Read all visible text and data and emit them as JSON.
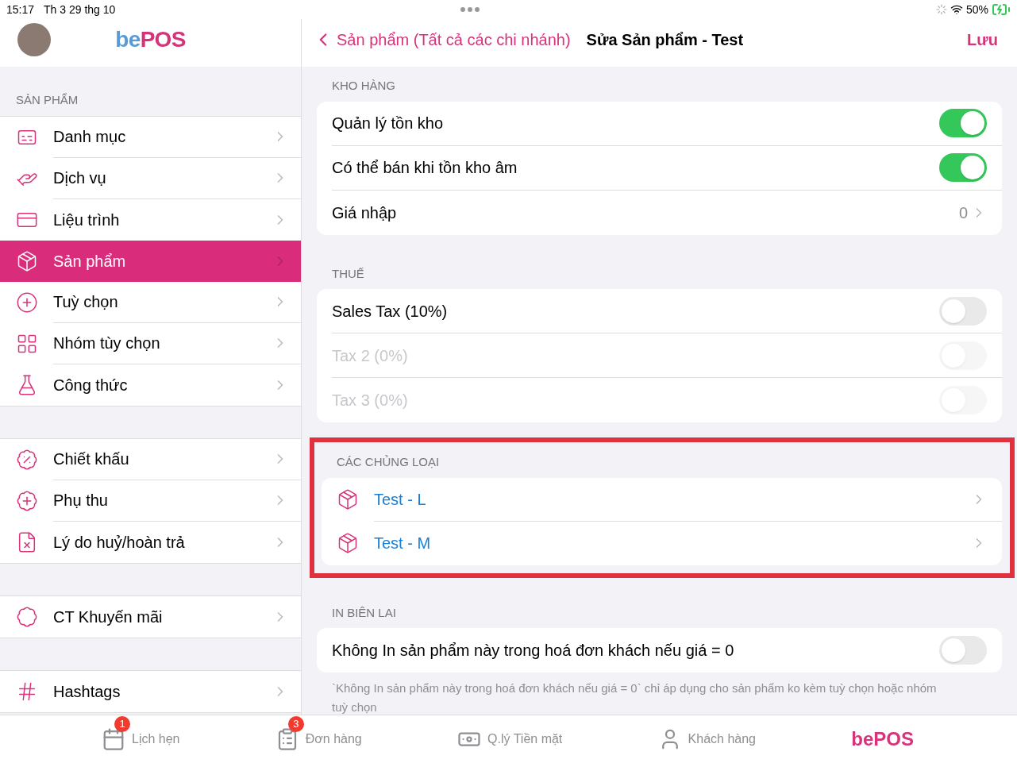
{
  "status_bar": {
    "time": "15:17",
    "date": "Th 3 29 thg 10",
    "battery": "50%"
  },
  "sidebar": {
    "logo": {
      "part_1": "be",
      "part_2": "POS"
    },
    "groups": [
      {
        "title": "SẢN PHẨM",
        "items": [
          {
            "label": "Danh mục",
            "selected": false
          },
          {
            "label": "Dịch vụ",
            "selected": false
          },
          {
            "label": "Liệu trình",
            "selected": false
          },
          {
            "label": "Sản phẩm",
            "selected": true
          },
          {
            "label": "Tuỳ chọn",
            "selected": false
          },
          {
            "label": "Nhóm tùy chọn",
            "selected": false
          },
          {
            "label": "Công thức",
            "selected": false
          }
        ]
      },
      {
        "items": [
          {
            "label": "Chiết khấu",
            "selected": false
          },
          {
            "label": "Phụ thu",
            "selected": false
          },
          {
            "label": "Lý do huỷ/hoàn trả",
            "selected": false
          }
        ]
      },
      {
        "items": [
          {
            "label": "CT Khuyến mãi",
            "selected": false
          }
        ]
      },
      {
        "items": [
          {
            "label": "Hashtags",
            "selected": false
          }
        ]
      }
    ]
  },
  "nav": {
    "back": "Sản phẩm (Tất cả các chi nhánh)",
    "title": "Sửa Sản phẩm - Test",
    "action": "Lưu"
  },
  "sections": [
    {
      "title": "KHO HÀNG",
      "highlighted": false,
      "rows": [
        {
          "kind": "toggle",
          "label": "Quản lý tồn kho",
          "on": true,
          "disabled": false
        },
        {
          "kind": "toggle",
          "label": "Có thể bán khi tồn kho âm",
          "on": true,
          "disabled": false
        },
        {
          "kind": "value",
          "label": "Giá nhập",
          "value": "0"
        }
      ]
    },
    {
      "title": "THUẾ",
      "highlighted": false,
      "rows": [
        {
          "kind": "toggle",
          "label": "Sales Tax (10%)",
          "on": false,
          "disabled": false
        },
        {
          "kind": "toggle",
          "label": "Tax 2 (0%)",
          "on": false,
          "disabled": true
        },
        {
          "kind": "toggle",
          "label": "Tax 3 (0%)",
          "on": false,
          "disabled": true
        }
      ]
    },
    {
      "title": "CÁC CHỦNG LOẠI",
      "highlighted": true,
      "rows": [
        {
          "kind": "link",
          "label": "Test - L"
        },
        {
          "kind": "link",
          "label": "Test - M"
        }
      ]
    },
    {
      "title": "IN BIÊN LAI",
      "highlighted": false,
      "rows": [
        {
          "kind": "toggle",
          "label": "Không In sản phẩm này trong hoá đơn khách nếu giá = 0",
          "on": false,
          "disabled": false
        }
      ],
      "footnote": "`Không In sản phẩm này trong hoá đơn khách nếu giá = 0` chỉ áp dụng cho sản phẩm ko kèm tuỳ chọn hoặc nhóm tuỳ chọn"
    }
  ],
  "tab_bar": [
    {
      "kind": "tab",
      "label": "Lịch hẹn",
      "badge": "1"
    },
    {
      "kind": "tab",
      "label": "Đơn hàng",
      "badge": "3"
    },
    {
      "kind": "tab",
      "label": "Q.lý Tiền mặt"
    },
    {
      "kind": "tab",
      "label": "Khách hàng"
    },
    {
      "kind": "logo",
      "label": "bePOS"
    }
  ]
}
